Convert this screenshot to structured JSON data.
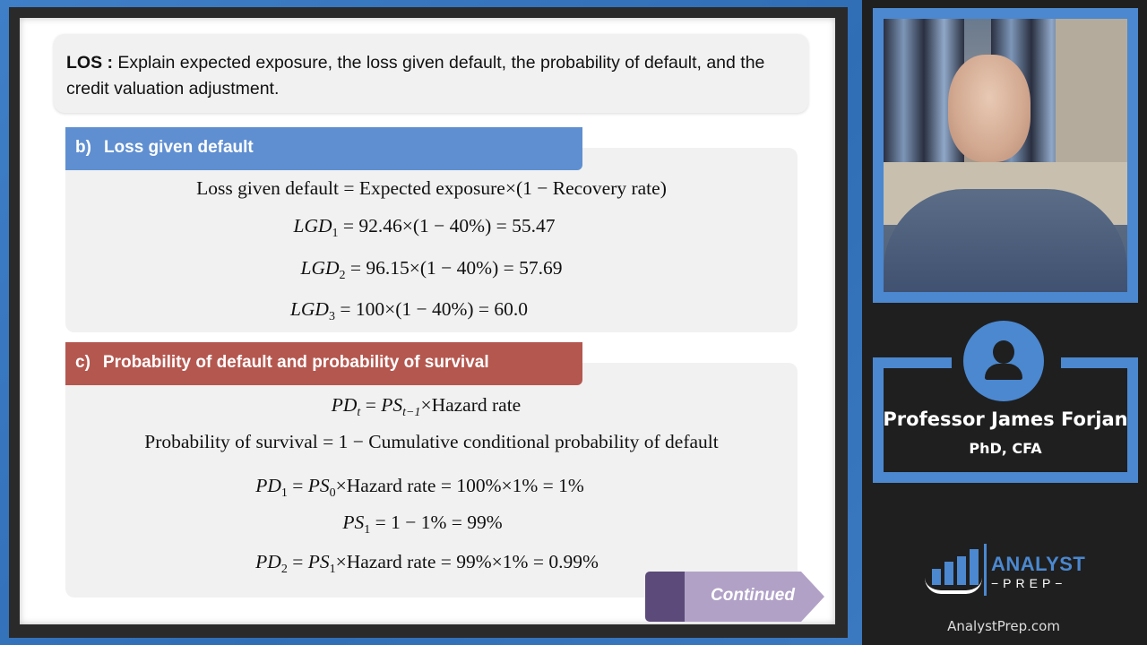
{
  "los": {
    "label": "LOS :",
    "text": " Explain expected exposure, the loss given default, the probability of default, and the credit valuation adjustment."
  },
  "section_b": {
    "marker": "b)",
    "title": "Loss given default",
    "formula": "Loss given default = Expected exposure×(1 − Recovery rate)",
    "rows": [
      {
        "var": "LGD",
        "sub": "1",
        "rhs": " = 92.46×(1 − 40%) = 55.47"
      },
      {
        "var": "LGD",
        "sub": "2",
        "rhs": " = 96.15×(1 − 40%) = 57.69"
      },
      {
        "var": "LGD",
        "sub": "3",
        "rhs": " = 100×(1 − 40%) = 60.0"
      }
    ]
  },
  "section_c": {
    "marker": "c)",
    "title": "Probability of default and probability of survival",
    "formula1": {
      "a": "PD",
      "a_sub": "t",
      "eq": " = ",
      "b": "PS",
      "b_sub": "t−1",
      "rest": "×Hazard rate"
    },
    "formula2": "Probability of survival = 1 − Cumulative conditional probability of default",
    "rows": [
      {
        "a": "PD",
        "a_sub": "1",
        "eq": " = ",
        "b": "PS",
        "b_sub": "0",
        "rest": "×Hazard rate = 100%×1% = 1%"
      },
      {
        "a": "PS",
        "a_sub": "1",
        "rest": " = 1 − 1% = 99%"
      },
      {
        "a": "PD",
        "a_sub": "2",
        "eq": " = ",
        "b": "PS",
        "b_sub": "1",
        "rest": "×Hazard rate = 99%×1% = 0.99%"
      }
    ]
  },
  "continued_button": "Continued",
  "presenter": {
    "name": "Professor James Forjan",
    "credentials": "PhD, CFA"
  },
  "brand": {
    "logo_line1": "ANALYST",
    "logo_line2": "−PREP−",
    "site": "AnalystPrep.com",
    "accent": "#4b88d0"
  }
}
